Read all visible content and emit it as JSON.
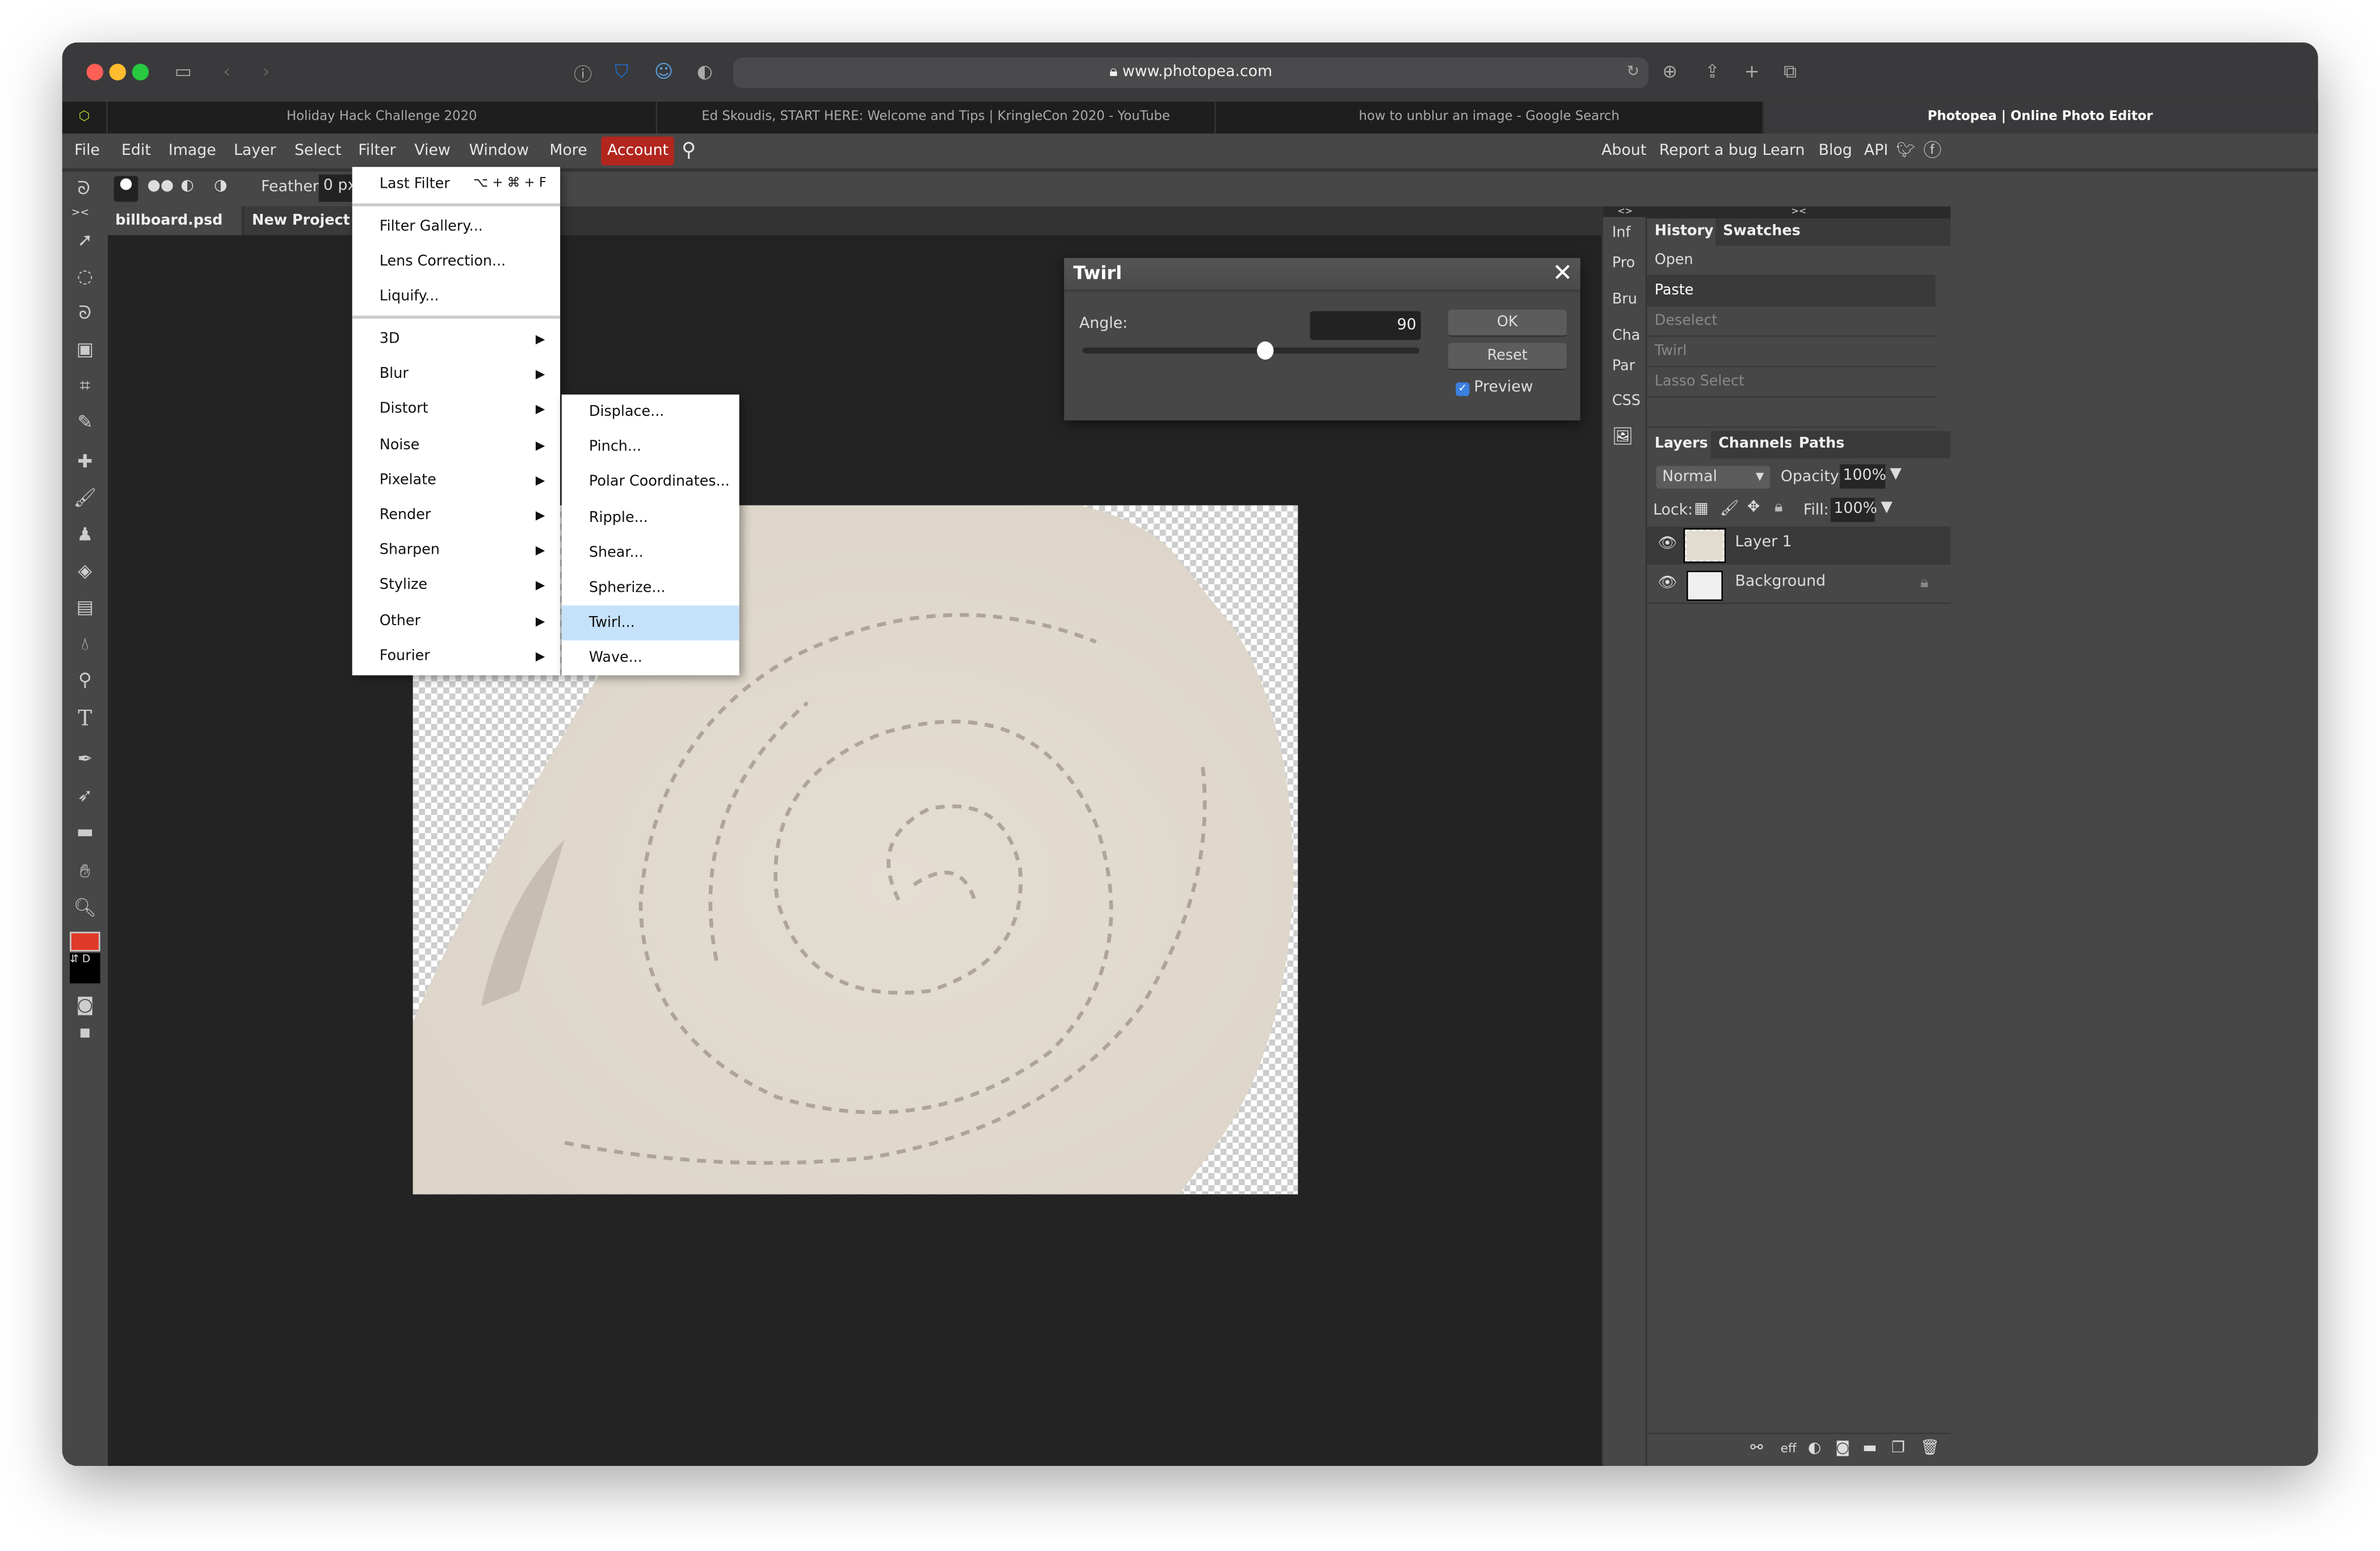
{
  "browser": {
    "url": "www.photopea.com",
    "tabs": [
      {
        "label": "Holiday Hack Challenge 2020"
      },
      {
        "label": "Ed Skoudis, START HERE: Welcome and Tips | KringleCon 2020 - YouTube"
      },
      {
        "label": "how to unblur an image - Google Search"
      },
      {
        "label": "Photopea | Online Photo Editor",
        "active": true
      }
    ]
  },
  "menubar": {
    "items": [
      "File",
      "Edit",
      "Image",
      "Layer",
      "Select",
      "Filter",
      "View",
      "Window",
      "More"
    ],
    "account": "Account",
    "right": [
      "About",
      "Report a bug",
      "Learn",
      "Blog",
      "API"
    ],
    "accent": "#b3261e"
  },
  "options": {
    "feather_label": "Feather:",
    "feather_value": "0",
    "unit": "px"
  },
  "doc_tabs": [
    {
      "label": "billboard.psd",
      "close": "×"
    },
    {
      "label": "New Project.p"
    }
  ],
  "filter_menu": {
    "last_filter": "Last Filter",
    "last_filter_shortcut": "⌥ + ⌘ + F",
    "group1": [
      "Filter Gallery...",
      "Lens Correction...",
      "Liquify..."
    ],
    "submenus": [
      "3D",
      "Blur",
      "Distort",
      "Noise",
      "Pixelate",
      "Render",
      "Sharpen",
      "Stylize",
      "Other",
      "Fourier"
    ]
  },
  "distort_menu": {
    "items": [
      "Displace...",
      "Pinch...",
      "Polar Coordinates...",
      "Ripple...",
      "Shear...",
      "Spherize...",
      "Twirl...",
      "Wave..."
    ],
    "highlighted": "Twirl..."
  },
  "twirl_dialog": {
    "title": "Twirl",
    "angle_label": "Angle:",
    "angle_value": "90",
    "slider_fraction": 0.54,
    "ok": "OK",
    "reset": "Reset",
    "preview_label": "Preview",
    "preview_checked": true
  },
  "side_tabs": [
    "Inf",
    "Pro",
    "Bru",
    "Cha",
    "Par",
    "CSS"
  ],
  "history": {
    "tabs": [
      "History",
      "Swatches"
    ],
    "items": [
      {
        "label": "Open",
        "state": "normal"
      },
      {
        "label": "Paste",
        "state": "selected"
      },
      {
        "label": "Deselect",
        "state": "dim"
      },
      {
        "label": "Twirl",
        "state": "dim"
      },
      {
        "label": "Lasso Select",
        "state": "dim"
      }
    ]
  },
  "layers": {
    "tabs": [
      "Layers",
      "Channels",
      "Paths"
    ],
    "blend_mode": "Normal",
    "opacity_label": "Opacity:",
    "opacity": "100%",
    "lock_label": "Lock:",
    "fill_label": "Fill:",
    "fill": "100%",
    "items": [
      {
        "name": "Layer 1",
        "selected": true
      },
      {
        "name": "Background",
        "locked": true
      }
    ],
    "footer_eff": "eff"
  },
  "colors": {
    "foreground": "#e03a2a",
    "background": "#000000"
  }
}
